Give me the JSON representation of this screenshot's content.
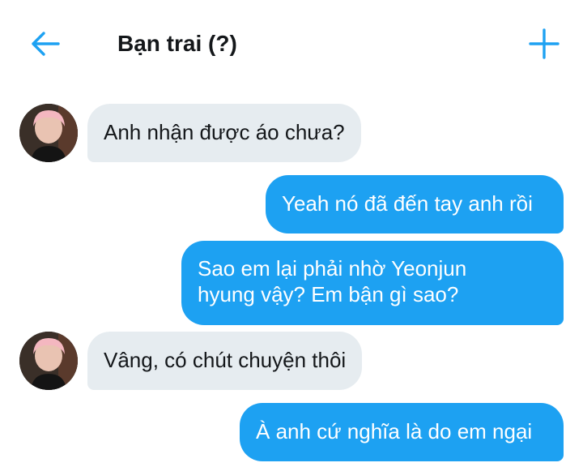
{
  "header": {
    "back_icon": "arrow-left-icon",
    "title": "Bạn trai (?)",
    "add_icon": "plus-icon",
    "accent_color": "#1da1f2"
  },
  "messages": [
    {
      "side": "incoming",
      "text": "Anh nhận được áo chưa?"
    },
    {
      "side": "outgoing",
      "text": "Yeah nó đã đến tay anh rồi"
    },
    {
      "side": "outgoing",
      "line1": "Sao em lại phải nhờ Yeonjun",
      "line2": "hyung vậy? Em bận gì sao?"
    },
    {
      "side": "incoming",
      "text": "Vâng, có chút chuyện thôi"
    },
    {
      "side": "outgoing",
      "text": "À anh cứ nghĩa là do em ngại"
    }
  ],
  "colors": {
    "incoming_bubble": "#e6ecf0",
    "outgoing_bubble": "#1da1f2",
    "text_dark": "#14171a"
  }
}
